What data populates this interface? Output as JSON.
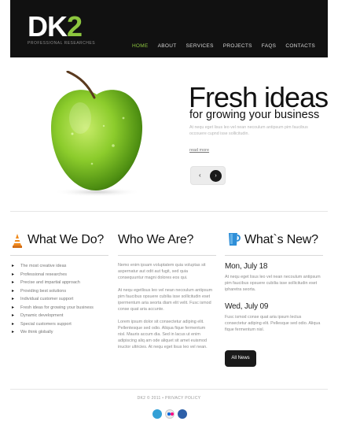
{
  "brand": {
    "logo_main": "DK",
    "logo_accent": "2",
    "tagline": "PROFESSIONAL RESEARCHES"
  },
  "nav": [
    {
      "label": "HOME",
      "active": true
    },
    {
      "label": "ABOUT",
      "active": false
    },
    {
      "label": "SERVICES",
      "active": false
    },
    {
      "label": "PROJECTS",
      "active": false
    },
    {
      "label": "FAQS",
      "active": false
    },
    {
      "label": "CONTACTS",
      "active": false
    }
  ],
  "hero": {
    "title": "Fresh ideas",
    "subtitle": "for growing your business",
    "text": "At nequ eget lisus leo vel nean necoulum antipsum pim faucibus occouere cupnd isse sollicitudin.",
    "read_more": "read more",
    "prev_label": "‹",
    "next_label": "›"
  },
  "what_we_do": {
    "title": "What We Do?",
    "items": [
      "The most creative ideas",
      "Professional researches",
      "Precise and impartial approach",
      "Providing best solutions",
      "Individual customer support",
      "Fresh ideas for growing your business",
      "Dynamic development",
      "Special customers support",
      "We think globally"
    ]
  },
  "who_we_are": {
    "title": "Who We Are?",
    "paragraphs": [
      "Nemo enim ipsam voluptatem quia voluptas sit aspernatur aut odit aut fugit, sed quia consequuntur magni dolores eos qui.",
      "At nequ egetlisus leo vel nean necoulum antipsum pim faucibus opsuere cubilia isse sollicitudin eset ipermentum aria seorta diam elit velit. Fusc ismod conse quat aria accunte.",
      "Lorem ipsum dolor sit consectetur adiping elit. Pellentesque sed odio. Aliqua fique fermentum nisl. Mauris accum dia. Sed in lacus ut enim adipiscing aliq am ode aliquet sit amet euismod inuctor ultricies. At nequ eget lisus leo vel nean."
    ]
  },
  "whats_new": {
    "title": "What`s New?",
    "items": [
      {
        "date": "Mon, July 18",
        "text": "At nequ eget lisus leo vel nean necoulum antipsum pim faucibus opsuere cubilia isse sollicitudin eset ipharetra seorta."
      },
      {
        "date": "Wed, July 09",
        "text": "Fusc ismod conse quat aria ipsum lectus consectetur adiping elit. Pellesque sed odio. Aliqua fique fermentum nisl."
      }
    ],
    "button": "All News"
  },
  "footer": {
    "text": "DK2 © 2011 • PRIVACY POLICY"
  },
  "social": [
    {
      "icon": "twitter-icon",
      "color": "#33a0d6"
    },
    {
      "icon": "flickr-icon",
      "color": "#d94a8c"
    },
    {
      "icon": "delicious-icon",
      "color": "#2d5fa8"
    }
  ],
  "colors": {
    "accent": "#8dc63f",
    "header_bg": "#111111"
  }
}
